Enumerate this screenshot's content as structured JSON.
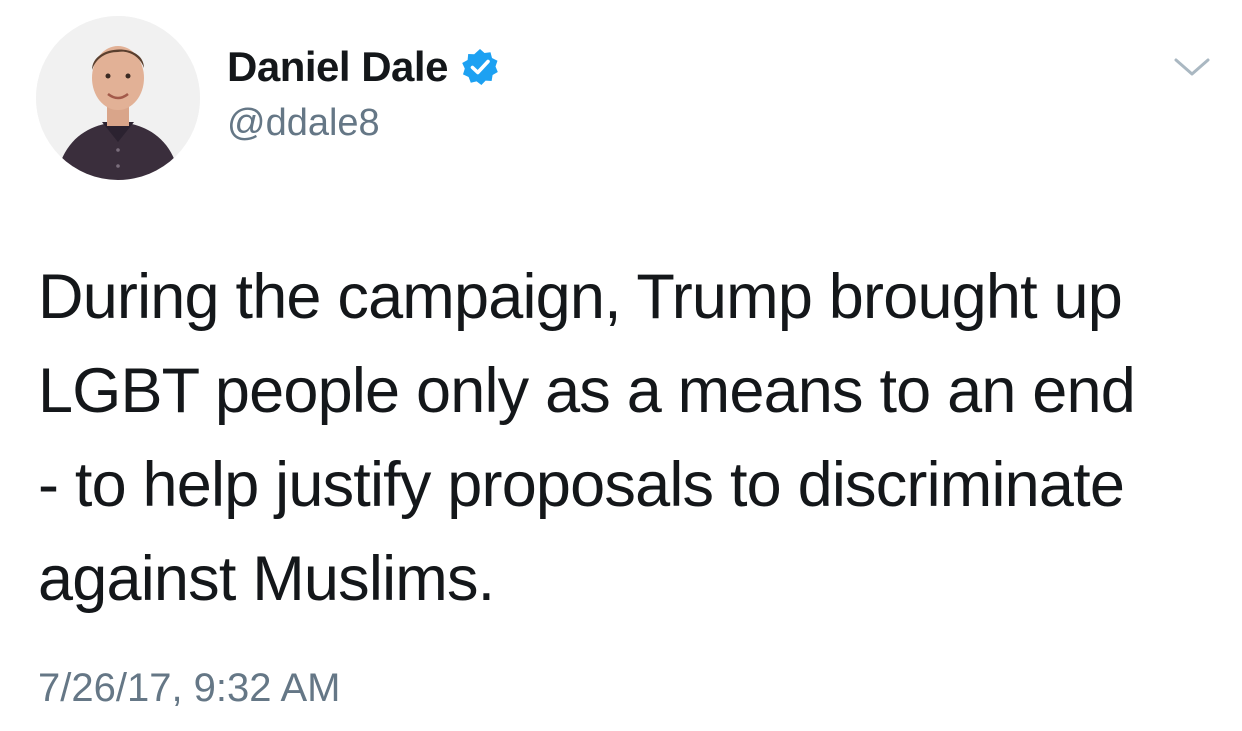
{
  "user": {
    "display_name": "Daniel Dale",
    "handle": "@ddale8",
    "verified": true,
    "avatar_icon": "profile-photo"
  },
  "tweet": {
    "text": "During the campaign, Trump brought up\nLGBT people only as a means to an end\n- to help justify proposals to discriminate\nagainst Muslims.",
    "timestamp": "7/26/17, 9:32 AM"
  },
  "menu": {
    "icon": "chevron-down-icon"
  },
  "colors": {
    "text": "#14171a",
    "secondary": "#657786",
    "verified_blue": "#1da1f2"
  }
}
